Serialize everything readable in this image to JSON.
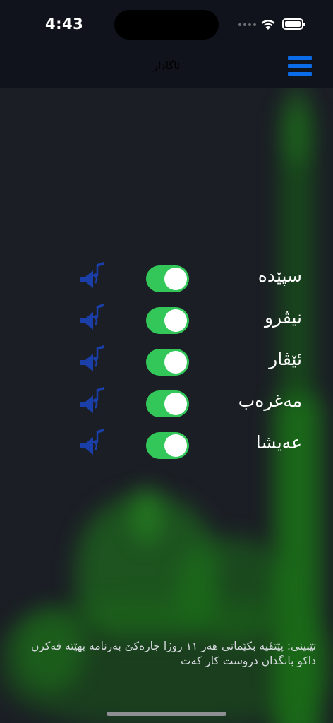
{
  "status_bar": {
    "time": "4:43"
  },
  "nav_bar": {
    "title": "ئاگادار",
    "menu_icon": "hamburger-menu-icon"
  },
  "prayers": [
    {
      "label": "سپێدە",
      "enabled": true,
      "speaker_icon": "speaker-music-icon"
    },
    {
      "label": "نیڤرو",
      "enabled": true,
      "speaker_icon": "speaker-music-icon"
    },
    {
      "label": "ئێڤار",
      "enabled": true,
      "speaker_icon": "speaker-music-icon"
    },
    {
      "label": "مەغرەب",
      "enabled": true,
      "speaker_icon": "speaker-music-icon"
    },
    {
      "label": "عەیشا",
      "enabled": true,
      "speaker_icon": "speaker-music-icon"
    }
  ],
  "note": "تێبینی: پێتڤیە بکێماتی هەر ١١ روژا جارەکێ بەرنامە بهێتە ڤەکرن داکو بانگدان دروست کار کەت",
  "colors": {
    "toggle_on": "#33c759",
    "accent_blue": "#0a6ce8",
    "speaker_blue": "#1a3fa8",
    "background": "#1b1e25",
    "glow_green": "#1f8a1a"
  }
}
